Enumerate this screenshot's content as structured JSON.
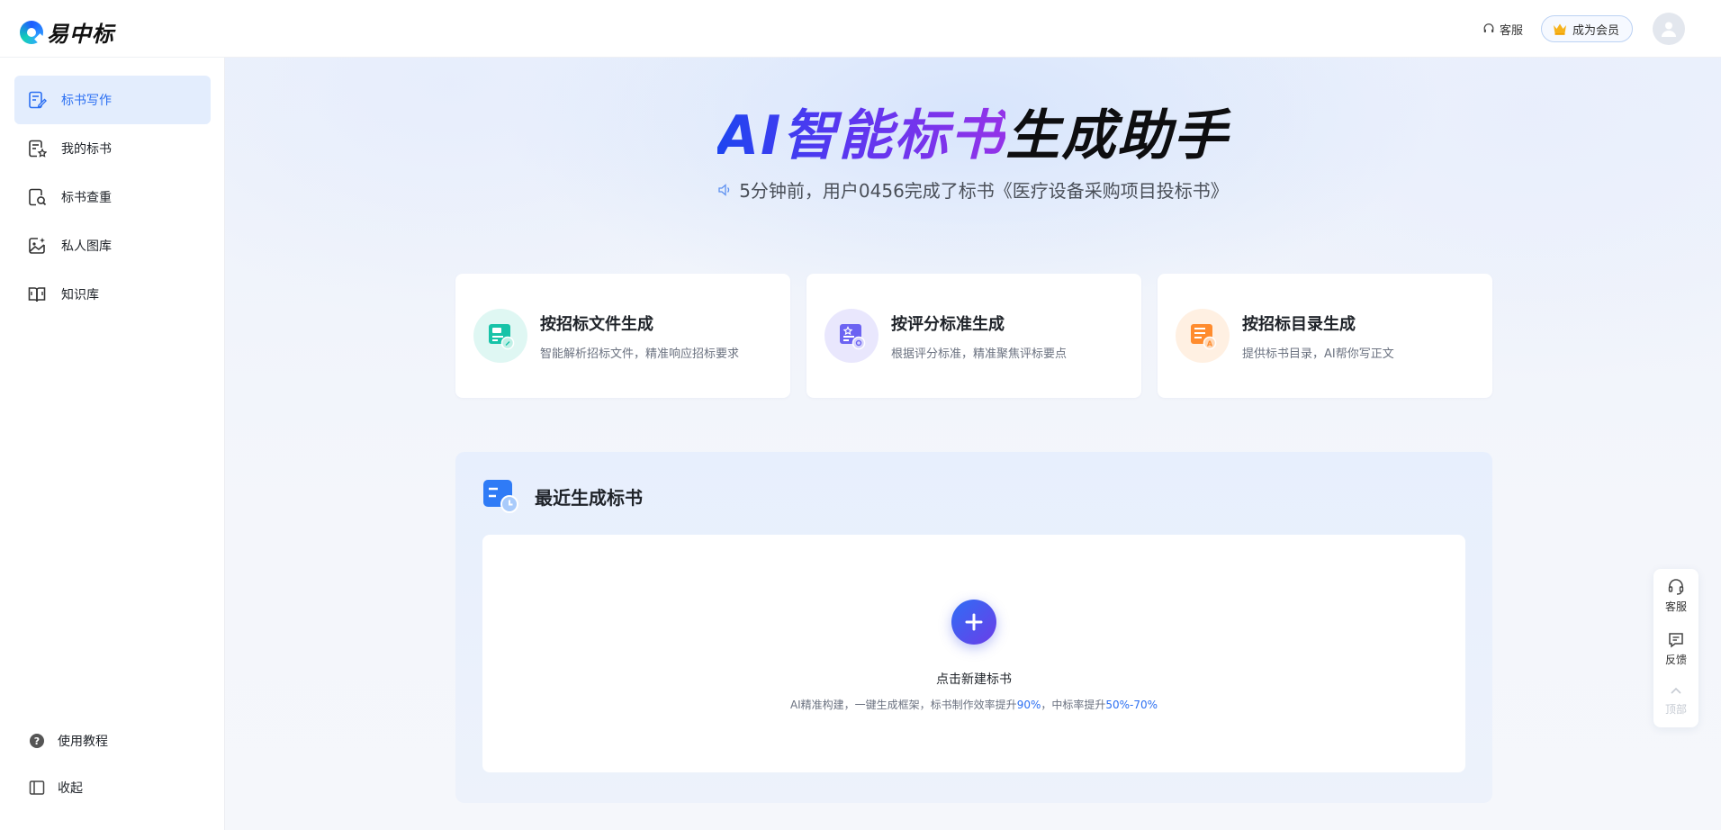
{
  "app": {
    "name": "易中标"
  },
  "header": {
    "service_label": "客服",
    "member_label": "成为会员"
  },
  "sidebar": {
    "items": [
      {
        "label": "标书写作",
        "icon": "edit-document-icon",
        "active": true
      },
      {
        "label": "我的标书",
        "icon": "starred-document-icon"
      },
      {
        "label": "标书查重",
        "icon": "document-search-icon"
      },
      {
        "label": "私人图库",
        "icon": "image-gallery-icon"
      },
      {
        "label": "知识库",
        "icon": "book-icon"
      }
    ],
    "footer": {
      "tutorial_label": "使用教程",
      "collapse_label": "收起"
    }
  },
  "hero": {
    "title_gradient": "AI智能标书",
    "title_dark": "生成助手",
    "notice": "5分钟前，用户0456完成了标书《医疗设备采购项目投标书》"
  },
  "cards": [
    {
      "title": "按招标文件生成",
      "desc": "智能解析招标文件，精准响应招标要求",
      "color": "#15c6b0"
    },
    {
      "title": "按评分标准生成",
      "desc": "根据评分标准，精准聚焦评标要点",
      "color": "#6a5ff0"
    },
    {
      "title": "按招标目录生成",
      "desc": "提供标书目录，AI帮你写正文",
      "color": "#ff8a2a"
    }
  ],
  "recent": {
    "title": "最近生成标书",
    "new_label": "点击新建标书",
    "desc_prefix": "AI精准构建，一键生成框架，标书制作效率提升",
    "desc_highlight1": "90%",
    "desc_middle": "，中标率提升",
    "desc_highlight2": "50%-70%"
  },
  "float_tools": {
    "service": "客服",
    "feedback": "反馈",
    "top": "顶部"
  },
  "colors": {
    "accent": "#2b6ff2",
    "active_bg": "#e3edfd"
  }
}
